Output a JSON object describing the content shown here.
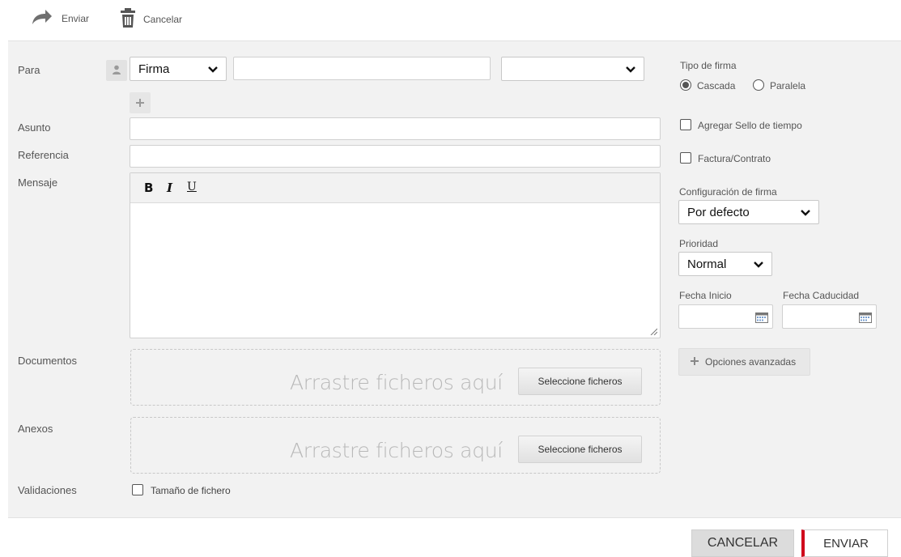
{
  "toolbar": {
    "send_label": "Enviar",
    "cancel_label": "Cancelar",
    "send_icon": "forward-arrow-icon",
    "cancel_icon": "trash-icon"
  },
  "form": {
    "to_label": "Para",
    "recipient_type": "Firma",
    "recipient_value": "",
    "recipient_option": "",
    "subject_label": "Asunto",
    "subject_value": "",
    "reference_label": "Referencia",
    "reference_value": "",
    "message_label": "Mensaje",
    "format_buttons": {
      "bold": "B",
      "italic": "I",
      "underline": "U"
    },
    "message_value": "",
    "documents_label": "Documentos",
    "attachments_label": "Anexos",
    "drop_text": "Arrastre ficheros aquí",
    "select_files_label": "Seleccione ficheros",
    "validations_label": "Validaciones",
    "file_size_label": "Tamaño de fichero",
    "file_size_checked": false
  },
  "options": {
    "signature_type_label": "Tipo de firma",
    "cascade_label": "Cascada",
    "parallel_label": "Paralela",
    "signature_type_selected": "Cascada",
    "timestamp_label": "Agregar Sello de tiempo",
    "timestamp_checked": false,
    "invoice_label": "Factura/Contrato",
    "invoice_checked": false,
    "signature_config_label": "Configuración de firma",
    "signature_config_value": "Por defecto",
    "priority_label": "Prioridad",
    "priority_value": "Normal",
    "start_date_label": "Fecha Inicio",
    "start_date_value": "",
    "expiry_date_label": "Fecha Caducidad",
    "expiry_date_value": "",
    "advanced_label": "Opciones avanzadas"
  },
  "footer": {
    "cancel_label": "CANCELAR",
    "send_label": "ENVIAR"
  },
  "colors": {
    "accent_red": "#d0021b",
    "panel_bg": "#f2f2f2"
  }
}
